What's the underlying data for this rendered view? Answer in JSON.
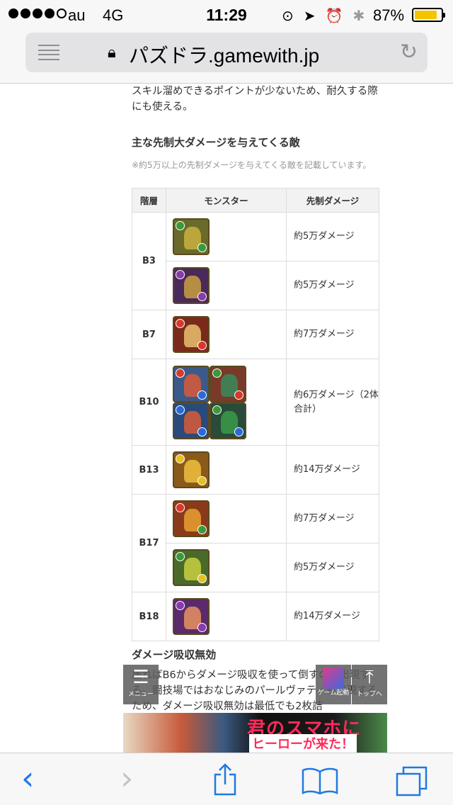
{
  "status": {
    "carrier": "au",
    "network": "4G",
    "time": "11:29",
    "battery": "87%",
    "battery_level": 0.87
  },
  "browser": {
    "domain": "パズドラ.gamewith.jp"
  },
  "content": {
    "intro_text": "スキル溜めできるポイントが少ないため、耐久する際にも使える。",
    "heading": "主な先制大ダメージを与えてくる敵",
    "note": "※約5万以上の先制ダメージを与えてくる敵を記載しています。",
    "table": {
      "headers": [
        "階層",
        "モンスター",
        "先制ダメージ"
      ],
      "rows": [
        {
          "floor": "B3",
          "damage": "約5万ダメージ"
        },
        {
          "floor": "",
          "damage": "約5万ダメージ"
        },
        {
          "floor": "B7",
          "damage": "約7万ダメージ"
        },
        {
          "floor": "B10",
          "damage": "約6万ダメージ（2体合計）"
        },
        {
          "floor": "B13",
          "damage": "約14万ダメージ"
        },
        {
          "floor": "B17",
          "damage": "約7万ダメージ"
        },
        {
          "floor": "",
          "damage": "約5万ダメージ"
        },
        {
          "floor": "B18",
          "damage": "約14万ダメージ"
        }
      ]
    },
    "heading2": "ダメージ吸収無効",
    "para2": "居ればB6からダメージ吸収を使って倒すのが出現する。闘技場ではおなじみのパールヴァティも出現するため、ダメージ吸収無効は最低でも2枚詰"
  },
  "floating": {
    "menu_label": "メニュー",
    "game_label": "ゲーム起動",
    "top_label": "トップへ"
  },
  "ad": {
    "line1": "君のスマホに",
    "line2": "ヒーローが来た！"
  },
  "colors": {
    "accent": "#1f7ae0",
    "battery": "#f5c400"
  }
}
